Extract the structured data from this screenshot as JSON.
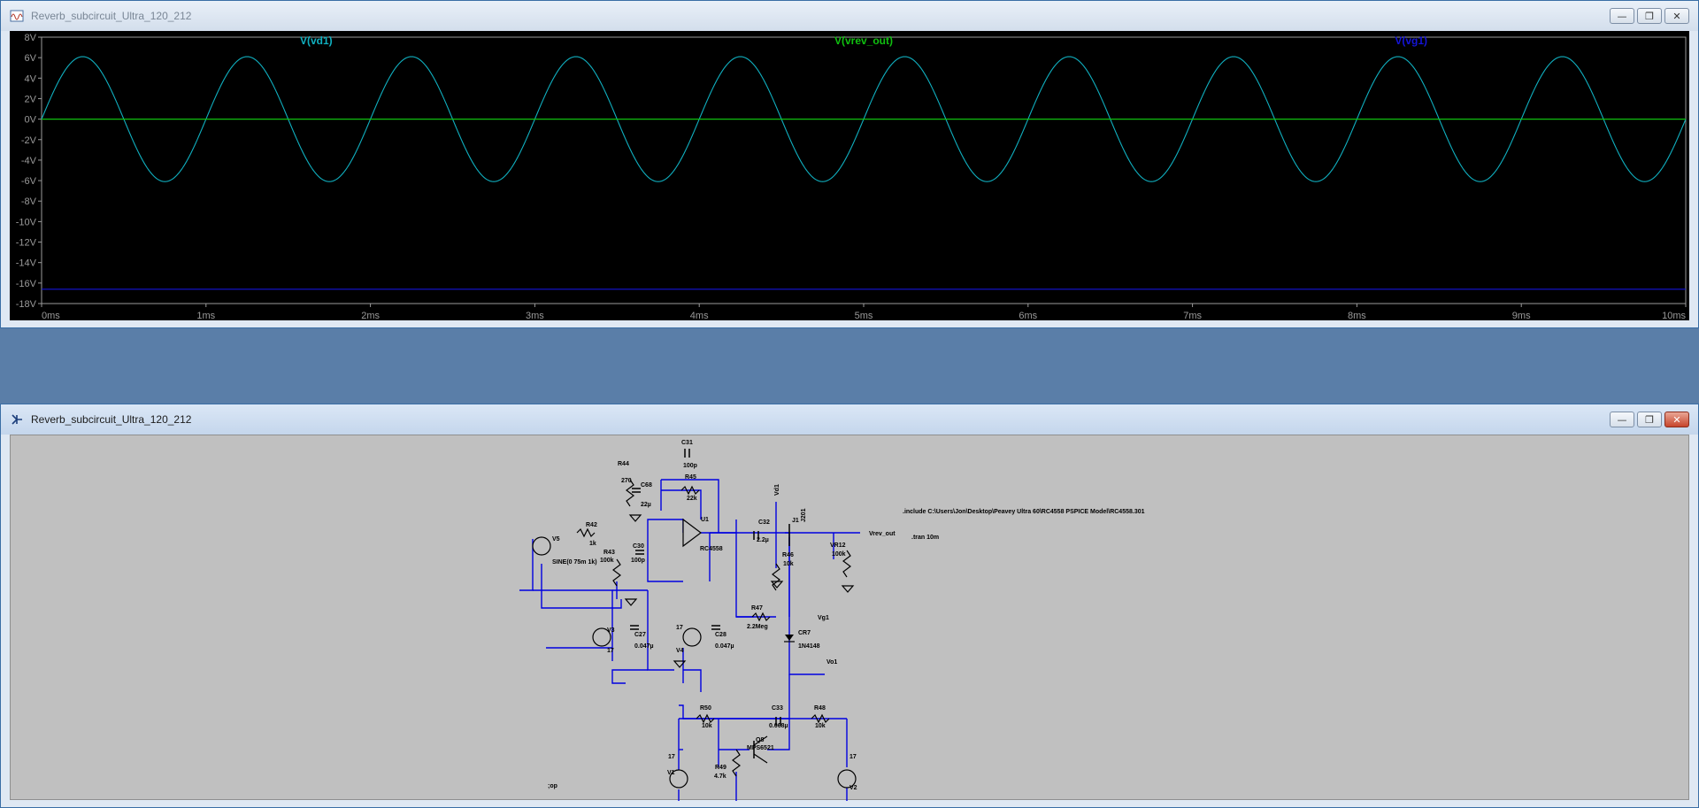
{
  "waveform_window": {
    "title": "Reverb_subcircuit_Ultra_120_212",
    "traces": [
      {
        "label": "V(vd1)",
        "color": "#10b0c0"
      },
      {
        "label": "V(vrev_out)",
        "color": "#10c010"
      },
      {
        "label": "V(vg1)",
        "color": "#1414d8"
      }
    ]
  },
  "schematic_window": {
    "title": "Reverb_subcircuit_Ultra_120_212",
    "labels": {
      "r44": "R44",
      "r44_val": "270",
      "c31": "C31",
      "c31_val": "100p",
      "r45": "R45",
      "r45_val": "22k",
      "c68": "C68",
      "c68_val": "22µ",
      "u1": "U1",
      "u1_model": "RC4558",
      "r42": "R42",
      "r42_val": "1k",
      "v5": "V5",
      "v5_val": "SINE(0 75m 1k)",
      "r43": "R43",
      "r43_val": "100k",
      "c30": "C30",
      "c30_val": "100p",
      "c32": "C32",
      "c32_val": "2.2µ",
      "vd1": "Vd1",
      "j1": "J1",
      "j1_model": "J201",
      "r46": "R46",
      "r46_val": "10k",
      "vr12": "VR12",
      "vr12_val": "100k",
      "vrev_out": "Vrev_out",
      "include": ".include C:\\Users\\Jon\\Desktop\\Peavey Ultra 60\\RC4558 PSPICE Model\\RC4558.301",
      "tran": ".tran 10m",
      "r47": "R47",
      "r47_val": "2.2Meg",
      "vg1": "Vg1",
      "v3": "V3",
      "v3_val": "17",
      "c27": "C27",
      "c27_val": "0.047µ",
      "v4": "V4",
      "v4_val": "17",
      "c28": "C28",
      "c28_val": "0.047µ",
      "cr7": "CR7",
      "cr7_model": "1N4148",
      "vo1": "Vo1",
      "r50": "R50",
      "r50_val": "10k",
      "c33": "C33",
      "c33_val": "0.068µ",
      "r48": "R48",
      "r48_val": "10k",
      "q8": "Q8",
      "q8_model": "MPS6521",
      "v1": "V1",
      "v1_val": "17",
      "r49": "R49",
      "r49_val": "4.7k",
      "v2": "V2",
      "v2_val": "17",
      "op": ";op"
    }
  },
  "chart_data": {
    "type": "line",
    "title": "",
    "xlabel": "",
    "ylabel": "",
    "x_ticks": [
      "0ms",
      "1ms",
      "2ms",
      "3ms",
      "4ms",
      "5ms",
      "6ms",
      "7ms",
      "8ms",
      "9ms",
      "10ms"
    ],
    "y_ticks": [
      "8V",
      "6V",
      "4V",
      "2V",
      "0V",
      "-2V",
      "-4V",
      "-6V",
      "-8V",
      "-10V",
      "-12V",
      "-14V",
      "-16V",
      "-18V"
    ],
    "xlim": [
      0,
      10
    ],
    "ylim": [
      -18,
      8
    ],
    "x_unit": "ms",
    "grid": false,
    "series": [
      {
        "name": "V(vd1)",
        "kind": "sine",
        "amplitude": 6.1,
        "offset": 0,
        "frequency_khz": 1,
        "phase": 0
      },
      {
        "name": "V(vrev_out)",
        "kind": "constant",
        "value": 0
      },
      {
        "name": "V(vg1)",
        "kind": "constant",
        "value": -16.6
      }
    ]
  }
}
